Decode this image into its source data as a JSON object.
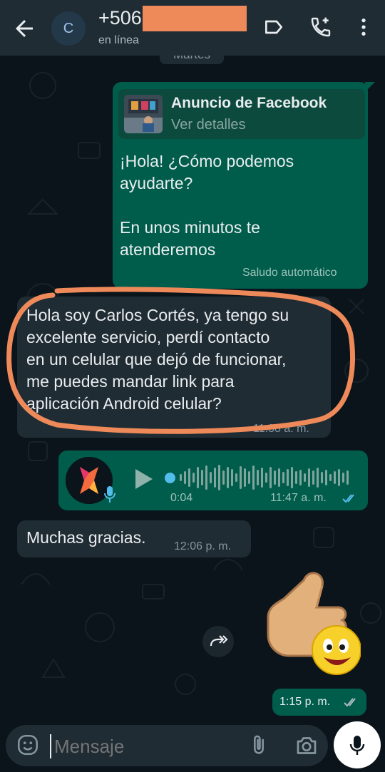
{
  "header": {
    "contact_name": "+506",
    "avatar_initial": "C",
    "status": "en línea",
    "icons": [
      "back-arrow-icon",
      "label-icon",
      "add-call-icon",
      "more-vert-icon"
    ]
  },
  "date_chip": "Martes",
  "messages": {
    "ad": {
      "card_title": "Anuncio de Facebook",
      "card_subtitle": "Ver detalles",
      "text": "¡Hola! ¿Cómo podemos\nayudarte?\n\nEn unos minutos te\natenderemos",
      "meta": "Saludo automático"
    },
    "incoming_1": {
      "text": "Hola soy Carlos Cortés, ya tengo su\nexcelente servicio, perdí contacto\nen un celular que dejó de funcionar,\nme puedes mandar link para\naplicación Android celular?",
      "time": "11:38 a. m."
    },
    "voice_note": {
      "duration": "0:04",
      "time": "11:47 a. m.",
      "status": "read",
      "progress": 0
    },
    "incoming_2": {
      "text": "Muchas gracias.",
      "time": "12:06 p. m."
    },
    "sticker": {
      "description": "thumbs-up-emoji-sticker",
      "time": "1:15 p. m.",
      "status": "read"
    }
  },
  "input": {
    "placeholder": "Mensaje"
  },
  "colors": {
    "background": "#0b141a",
    "header": "#1f2c34",
    "outgoing_bubble": "#005c4b",
    "incoming_bubble": "#202c33",
    "read_ticks": "#53bdeb",
    "annotation": "#ee8a5a"
  }
}
